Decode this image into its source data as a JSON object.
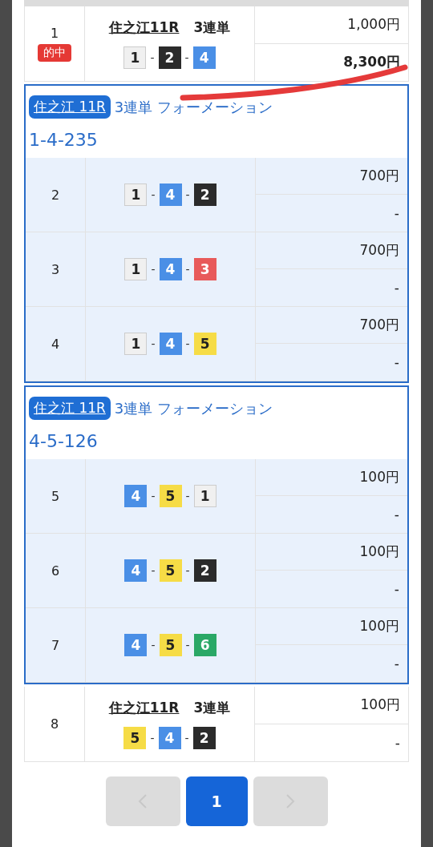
{
  "tickets": [
    {
      "kind": "single",
      "number": "1",
      "hit": true,
      "hit_label": "的中",
      "race": "住之江11R",
      "bet_type": "3連単",
      "boats": [
        {
          "num": "1",
          "color": "#f0f0f0"
        },
        {
          "sep": "-",
          "num": "2",
          "color": "#2b2b2b"
        },
        {
          "sep": "-",
          "num": "4",
          "color": "#4a8fe6"
        }
      ],
      "stake": "1,000円",
      "payout": "8,300円"
    },
    {
      "kind": "group",
      "race": "住之江 11R",
      "bet_type": "3連単 フォーメーション",
      "formation": "1-4-235",
      "rows": [
        {
          "number": "2",
          "boats": [
            {
              "num": "1",
              "color": "#f0f0f0"
            },
            {
              "sep": "-",
              "num": "4",
              "color": "#4a8fe6"
            },
            {
              "sep": "-",
              "num": "2",
              "color": "#2b2b2b"
            }
          ],
          "stake": "700円",
          "payout": "-"
        },
        {
          "number": "3",
          "boats": [
            {
              "num": "1",
              "color": "#f0f0f0"
            },
            {
              "sep": "-",
              "num": "4",
              "color": "#4a8fe6"
            },
            {
              "sep": "-",
              "num": "3",
              "color": "#e85a5a"
            }
          ],
          "stake": "700円",
          "payout": "-"
        },
        {
          "number": "4",
          "boats": [
            {
              "num": "1",
              "color": "#f0f0f0"
            },
            {
              "sep": "-",
              "num": "4",
              "color": "#4a8fe6"
            },
            {
              "sep": "-",
              "num": "5",
              "color": "#f6dc46"
            }
          ],
          "stake": "700円",
          "payout": "-"
        }
      ]
    },
    {
      "kind": "group",
      "race": "住之江 11R",
      "bet_type": "3連単 フォーメーション",
      "formation": "4-5-126",
      "rows": [
        {
          "number": "5",
          "boats": [
            {
              "num": "4",
              "color": "#4a8fe6"
            },
            {
              "sep": "-",
              "num": "5",
              "color": "#f6dc46"
            },
            {
              "sep": "-",
              "num": "1",
              "color": "#f0f0f0"
            }
          ],
          "stake": "100円",
          "payout": "-"
        },
        {
          "number": "6",
          "boats": [
            {
              "num": "4",
              "color": "#4a8fe6"
            },
            {
              "sep": "-",
              "num": "5",
              "color": "#f6dc46"
            },
            {
              "sep": "-",
              "num": "2",
              "color": "#2b2b2b"
            }
          ],
          "stake": "100円",
          "payout": "-"
        },
        {
          "number": "7",
          "boats": [
            {
              "num": "4",
              "color": "#4a8fe6"
            },
            {
              "sep": "-",
              "num": "5",
              "color": "#f6dc46"
            },
            {
              "sep": "-",
              "num": "6",
              "color": "#2aa866"
            }
          ],
          "stake": "100円",
          "payout": "-"
        }
      ]
    },
    {
      "kind": "single",
      "number": "8",
      "hit": false,
      "race": "住之江11R",
      "bet_type": "3連単",
      "boats": [
        {
          "num": "5",
          "color": "#f6dc46"
        },
        {
          "sep": "-",
          "num": "4",
          "color": "#4a8fe6"
        },
        {
          "sep": "-",
          "num": "2",
          "color": "#2b2b2b"
        }
      ],
      "stake": "100円",
      "payout": "-"
    }
  ],
  "pagination": {
    "prev": {
      "disabled": true
    },
    "pages": [
      {
        "label": "1",
        "selected": true
      }
    ],
    "next": {
      "disabled": true
    }
  }
}
